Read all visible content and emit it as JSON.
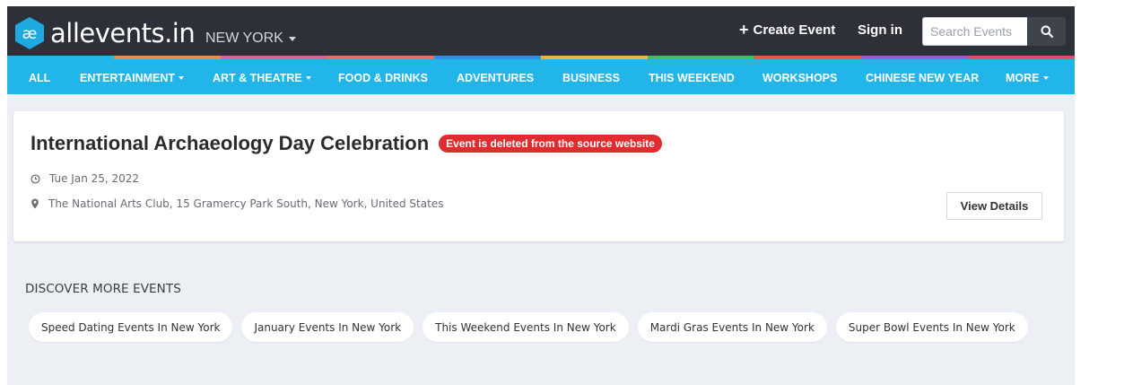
{
  "header": {
    "logo_text": "allevents.in",
    "city": "NEW YORK",
    "create_event": "Create Event",
    "sign_in": "Sign in",
    "search_placeholder": "Search Events"
  },
  "nav": {
    "items": [
      {
        "label": "ALL",
        "dropdown": false
      },
      {
        "label": "ENTERTAINMENT",
        "dropdown": true
      },
      {
        "label": "ART & THEATRE",
        "dropdown": true
      },
      {
        "label": "FOOD & DRINKS",
        "dropdown": false
      },
      {
        "label": "ADVENTURES",
        "dropdown": false
      },
      {
        "label": "BUSINESS",
        "dropdown": false
      },
      {
        "label": "THIS WEEKEND",
        "dropdown": false
      },
      {
        "label": "WORKSHOPS",
        "dropdown": false
      },
      {
        "label": "CHINESE NEW YEAR",
        "dropdown": false
      },
      {
        "label": "MORE",
        "dropdown": true
      }
    ],
    "stripe_colors": [
      "#22b5ea",
      "#f28a3c",
      "#e45f9a",
      "#f26b6b",
      "#2d8fe6",
      "#f2b33c",
      "#3fbf5f",
      "#e85a3c",
      "#9b59d6",
      "#e24a7a"
    ]
  },
  "event": {
    "title": "International Archaeology Day Celebration",
    "status_badge": "Event is deleted from the source website",
    "date": "Tue Jan 25, 2022",
    "location": "The National Arts Club, 15 Gramercy Park South, New York, United States",
    "view_details": "View Details"
  },
  "discover": {
    "title": "DISCOVER MORE EVENTS",
    "chips": [
      "Speed Dating Events In New York",
      "January Events In New York",
      "This Weekend Events In New York",
      "Mardi Gras Events In New York",
      "Super Bowl Events In New York"
    ]
  },
  "colors": {
    "header_bg": "#2d3038",
    "nav_bg": "#22b5ea",
    "logo_blue": "#1fa9e1",
    "badge_red": "#e02b2f",
    "page_bg": "#eceff3"
  }
}
